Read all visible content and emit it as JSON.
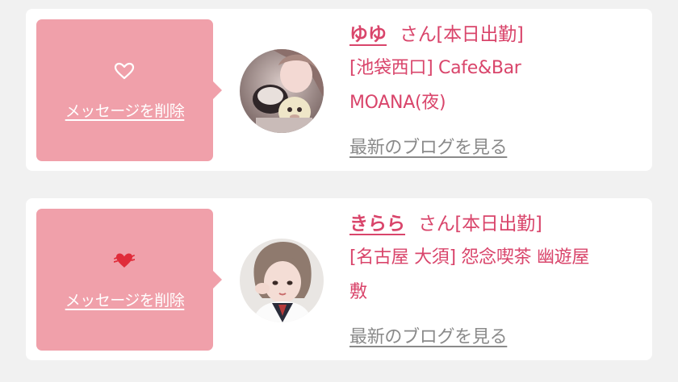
{
  "colors": {
    "accent": "#d9456b",
    "message_box": "#f0a0aa",
    "card_background": "#ffffff",
    "page_background": "#f1f1f1",
    "blog_link": "#8a8a8a"
  },
  "cards": [
    {
      "heart_icon": "heart-outline-icon",
      "message_label": "メッセージを削除",
      "avatar_icon": "profile-photo",
      "name": "ゆゆ",
      "suffix": "さん[本日出勤]",
      "shop_line1": "[池袋西口] Cafe&Bar",
      "shop_line2": "MOANA(夜)",
      "blog_link": "最新のブログを見る"
    },
    {
      "heart_icon": "heart-filled-icon",
      "message_label": "メッセージを削除",
      "avatar_icon": "profile-photo",
      "name": "きらら",
      "suffix": "さん[本日出勤]",
      "shop_line1": "[名古屋 大須] 怨念喫茶 幽遊屋",
      "shop_line2": "敷",
      "blog_link": "最新のブログを見る"
    }
  ]
}
